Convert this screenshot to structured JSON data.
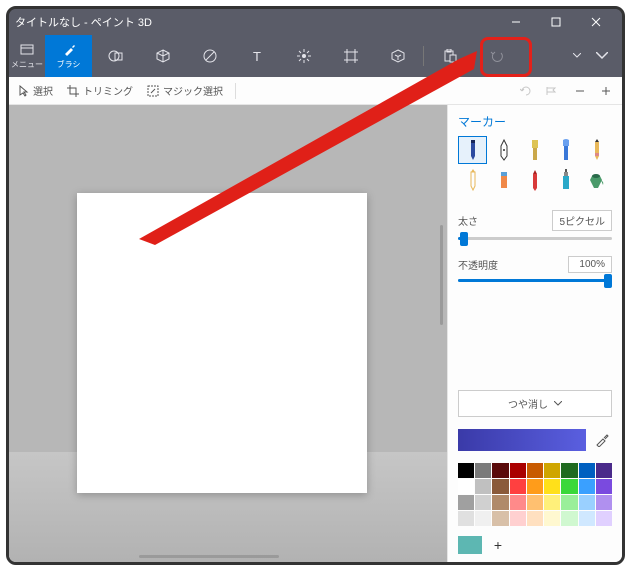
{
  "window": {
    "title": "タイトルなし - ペイント 3D"
  },
  "menu_label": "メニュー",
  "tools": {
    "brush": "ブラシ"
  },
  "secondbar": {
    "select": "選択",
    "trimming": "トリミング",
    "magic": "マジック選択"
  },
  "panel": {
    "title": "マーカー",
    "thickness_label": "太さ",
    "thickness_value": "5ピクセル",
    "opacity_label": "不透明度",
    "opacity_value": "100%",
    "finish": "つや消し"
  },
  "palette_colors": [
    "#000000",
    "#7a7a7a",
    "#5a0a0a",
    "#a00",
    "#c85a00",
    "#cfa500",
    "#1f6a1f",
    "#0060c0",
    "#4a2a8a",
    "#ffffff",
    "#c0c0c0",
    "#8a5a3a",
    "#ff4040",
    "#ff9c1a",
    "#ffe01a",
    "#3ad83a",
    "#3aa0ff",
    "#7a4adf",
    "#a0a0a0",
    "#d0d0d0",
    "#b08a6a",
    "#ff8a8a",
    "#ffc070",
    "#fff07a",
    "#9aef9a",
    "#9ad0ff",
    "#b090ef",
    "#e0e0e0",
    "#f0f0f0",
    "#d8c0a8",
    "#ffd0d0",
    "#ffe0c0",
    "#fff8d0",
    "#d0f8d0",
    "#d0e8ff",
    "#e0d0ff"
  ],
  "recent_color": "#5db7b2"
}
